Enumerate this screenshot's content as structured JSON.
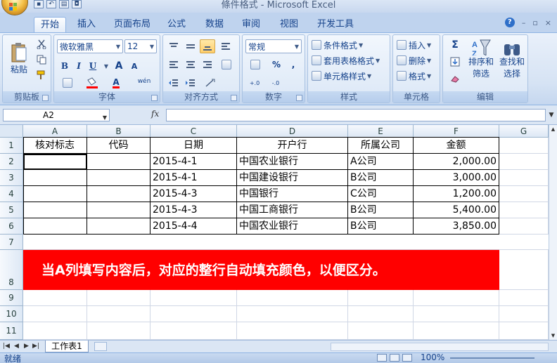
{
  "window": {
    "title": "條件格式 - Microsoft Excel"
  },
  "tabs": [
    "开始",
    "插入",
    "页面布局",
    "公式",
    "数据",
    "审阅",
    "视图",
    "开发工具"
  ],
  "ribbon": {
    "clipboard": {
      "label": "剪贴板",
      "paste": "粘贴"
    },
    "font": {
      "label": "字体",
      "name": "微软雅黑",
      "size": "12",
      "bold": "B",
      "italic": "I",
      "underline": "U",
      "grow": "A",
      "shrink": "A",
      "color": "A",
      "phonetic": "wén"
    },
    "alignment": {
      "label": "对齐方式"
    },
    "number": {
      "label": "数字",
      "format": "常规",
      "percent": "%",
      "comma": ",",
      "inc": "+.0",
      "dec": "-.0"
    },
    "styles": {
      "label": "样式",
      "conditional": "条件格式",
      "table": "套用表格格式",
      "cell": "单元格样式"
    },
    "cells": {
      "label": "单元格",
      "insert": "插入",
      "delete": "删除",
      "format": "格式"
    },
    "editing": {
      "label": "编辑",
      "sum": "Σ",
      "sort_line1": "排序和",
      "sort_line2": "筛选",
      "find_line1": "查找和",
      "find_line2": "选择"
    }
  },
  "formula_bar": {
    "name_box": "A2",
    "fx": "fx",
    "value": ""
  },
  "columns": [
    "A",
    "B",
    "C",
    "D",
    "E",
    "F",
    "G"
  ],
  "rows": [
    "1",
    "2",
    "3",
    "4",
    "5",
    "6",
    "7",
    "8",
    "9",
    "10",
    "11"
  ],
  "table": {
    "headers": [
      "核对标志",
      "代码",
      "日期",
      "开户行",
      "所属公司",
      "金额"
    ],
    "rows": [
      [
        "",
        "",
        "2015-4-1",
        "中国农业银行",
        "A公司",
        "2,000.00"
      ],
      [
        "",
        "",
        "2015-4-1",
        "中国建设银行",
        "B公司",
        "3,000.00"
      ],
      [
        "",
        "",
        "2015-4-3",
        "中国银行",
        "C公司",
        "1,200.00"
      ],
      [
        "",
        "",
        "2015-4-3",
        "中国工商银行",
        "B公司",
        "5,400.00"
      ],
      [
        "",
        "",
        "2015-4-4",
        "中国农业银行",
        "B公司",
        "3,850.00"
      ]
    ]
  },
  "banner": "当A列填写内容后，对应的整行自动填充颜色，以便区分。",
  "sheet_tabs": [
    "工作表1"
  ],
  "status": {
    "ready": "就绪",
    "zoom": "100%"
  },
  "colors": {
    "banner": "#ff0000",
    "selected_header": "#f1c05c"
  }
}
